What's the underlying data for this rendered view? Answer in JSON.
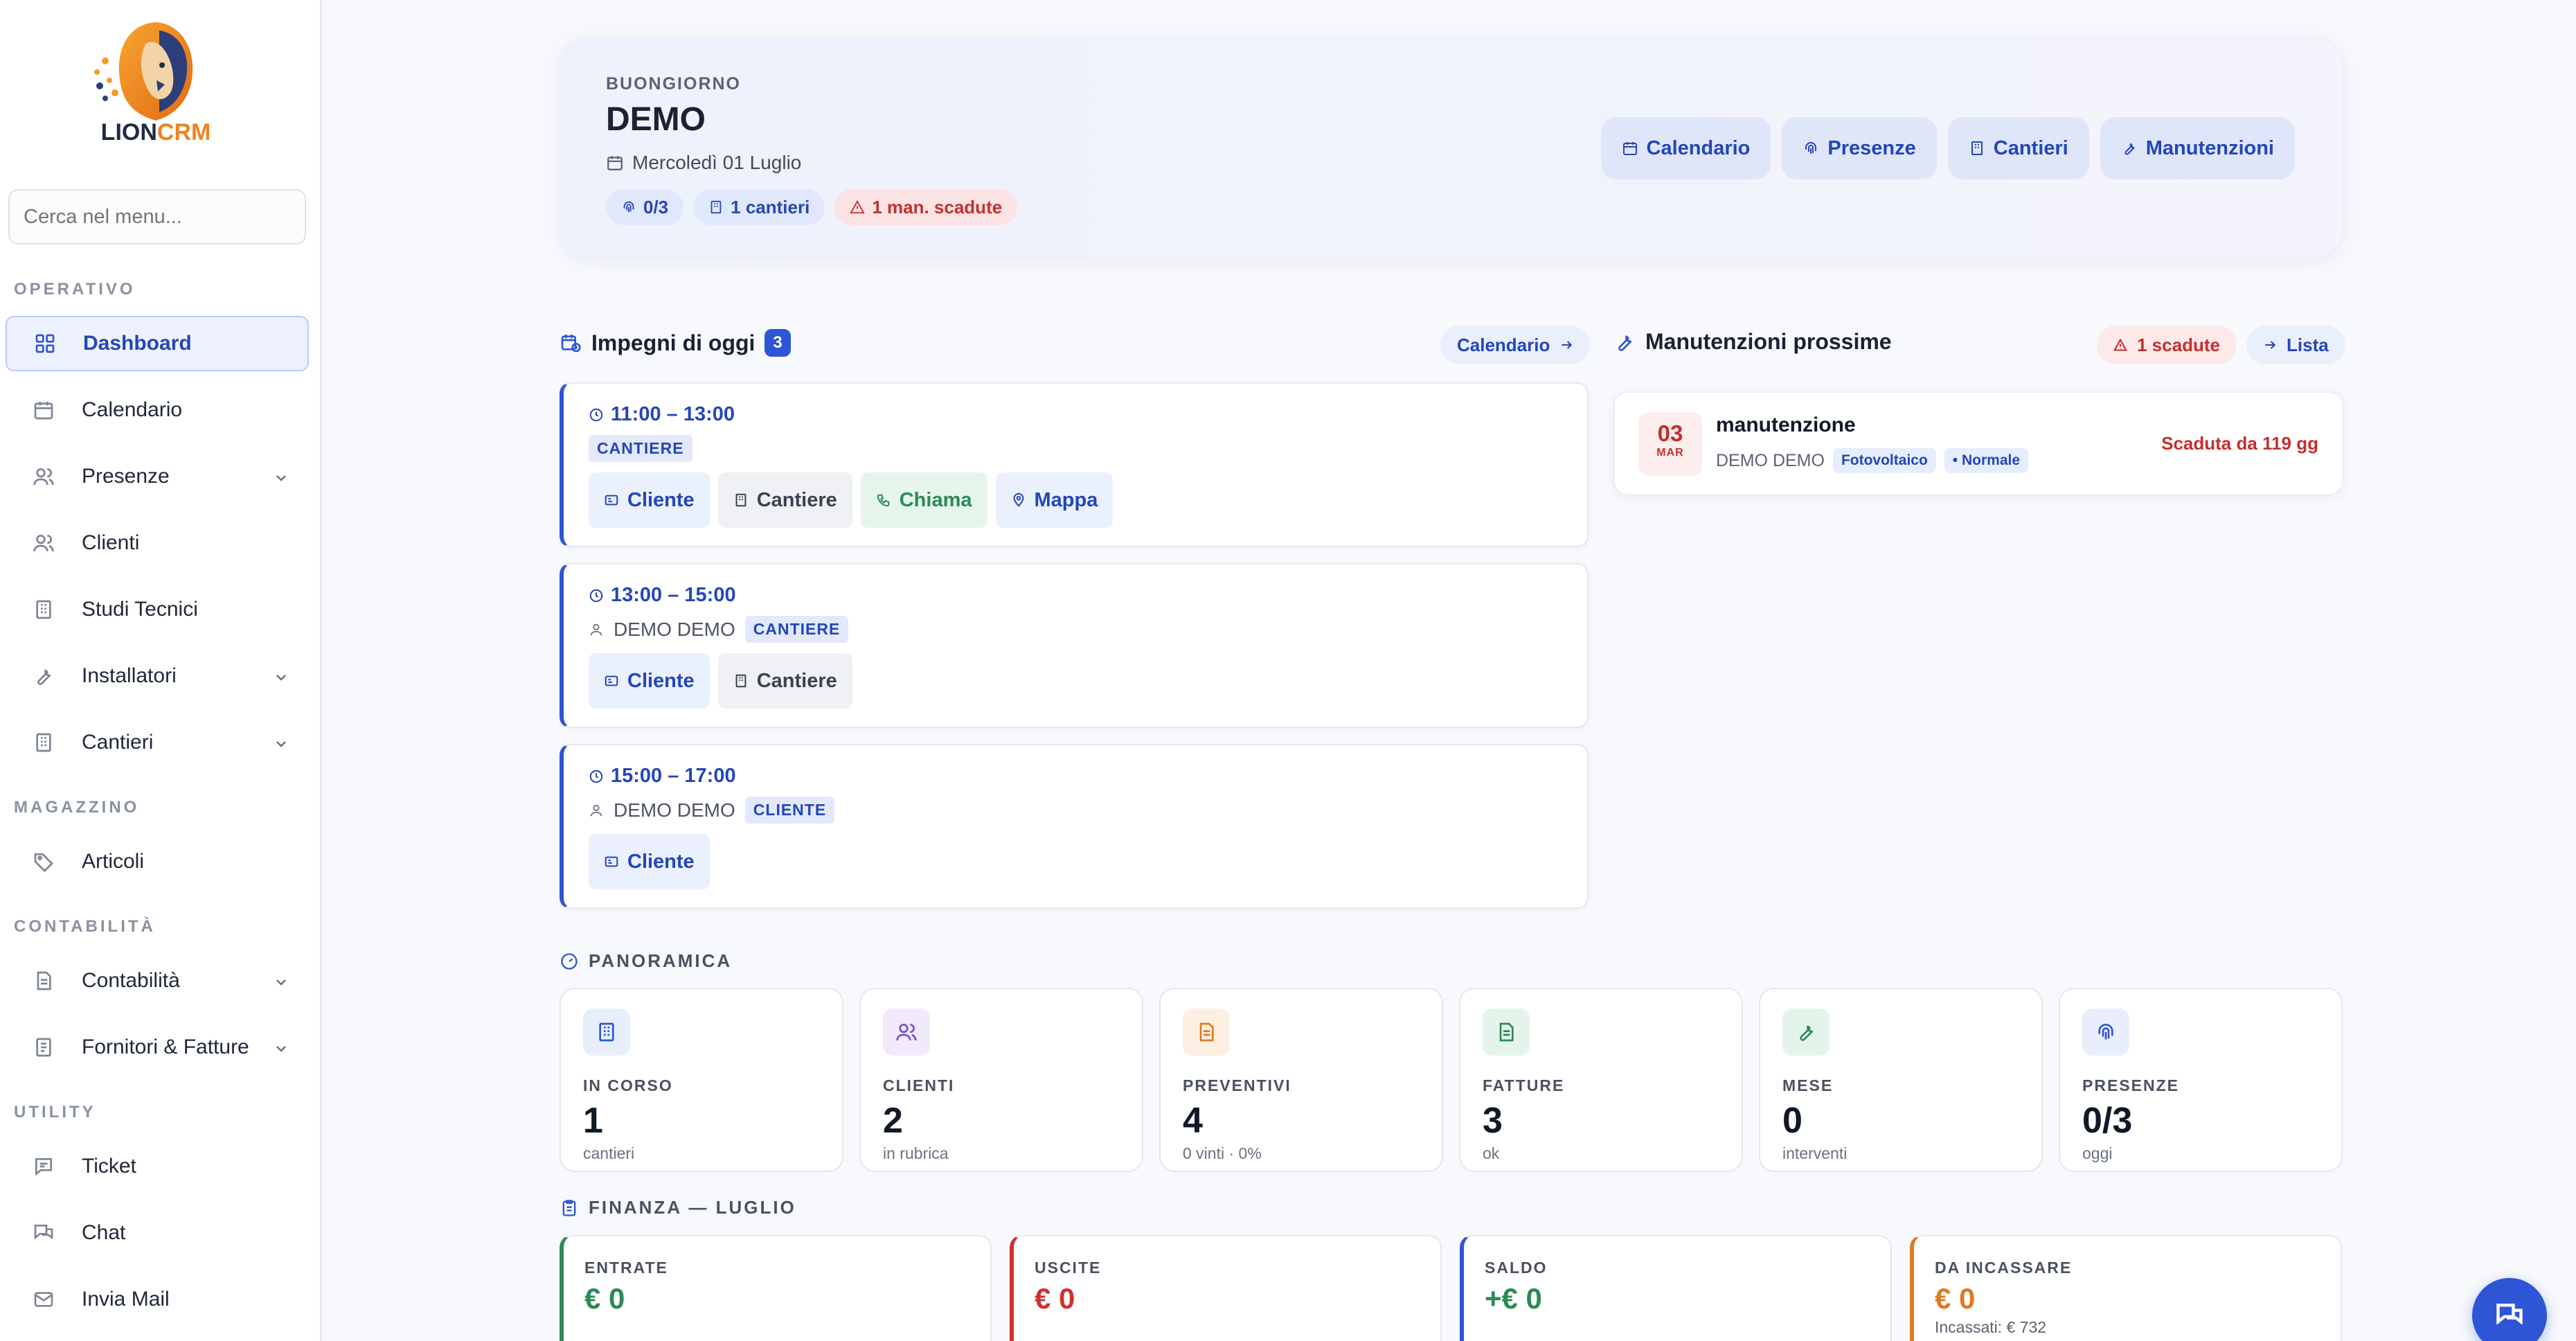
{
  "app": {
    "logo_word_a": "LION",
    "logo_word_b": "CRM"
  },
  "sidebar": {
    "search_placeholder": "Cerca nel menu...",
    "sections": {
      "operativo": "OPERATIVO",
      "magazzino": "MAGAZZINO",
      "contabilita": "CONTABILITÀ",
      "utility": "UTILITY"
    },
    "items": {
      "dashboard": "Dashboard",
      "calendario": "Calendario",
      "presenze": "Presenze",
      "clienti": "Clienti",
      "studi": "Studi Tecnici",
      "installatori": "Installatori",
      "cantieri": "Cantieri",
      "articoli": "Articoli",
      "contabilita": "Contabilità",
      "fornitori": "Fornitori & Fatture",
      "ticket": "Ticket",
      "chat": "Chat",
      "mail": "Invia Mail"
    }
  },
  "hero": {
    "greeting": "BUONGIORNO",
    "name": "DEMO",
    "date": "Mercoledì 01 Luglio",
    "badges": {
      "presenze": "0/3",
      "cantieri": "1 cantieri",
      "scadute": "1 man. scadute"
    },
    "actions": {
      "calendario": "Calendario",
      "presenze": "Presenze",
      "cantieri": "Cantieri",
      "manutenzioni": "Manutenzioni"
    }
  },
  "impegni": {
    "title": "Impegni di oggi",
    "count": "3",
    "link": "Calendario",
    "items": [
      {
        "time": "11:00 – 13:00",
        "tag": "CANTIERE",
        "btn_cliente": "Cliente",
        "btn_cantiere": "Cantiere",
        "btn_chiama": "Chiama",
        "btn_mappa": "Mappa"
      },
      {
        "time": "13:00 – 15:00",
        "person": "DEMO DEMO",
        "tag": "CANTIERE",
        "btn_cliente": "Cliente",
        "btn_cantiere": "Cantiere"
      },
      {
        "time": "15:00 – 17:00",
        "person": "DEMO DEMO",
        "tag": "CLIENTE",
        "btn_cliente": "Cliente"
      }
    ]
  },
  "manutenzioni": {
    "title": "Manutenzioni prossime",
    "overdue_pill": "1 scadute",
    "list_link": "Lista",
    "item": {
      "day": "03",
      "month": "MAR",
      "title": "manutenzione",
      "client": "DEMO DEMO",
      "type": "Fotovoltaico",
      "priority": "Normale",
      "status": "Scaduta da 119 gg"
    }
  },
  "panoramica": {
    "title": "PANORAMICA",
    "kpis": [
      {
        "label": "IN CORSO",
        "value": "1",
        "sub": "cantieri",
        "icon": "building-icon",
        "color": "#2e55d6"
      },
      {
        "label": "CLIENTI",
        "value": "2",
        "sub": "in rubrica",
        "icon": "users-icon",
        "color": "#7c4dce"
      },
      {
        "label": "PREVENTIVI",
        "value": "4",
        "sub": "0 vinti · 0%",
        "icon": "document-icon",
        "color": "#e07a1f"
      },
      {
        "label": "FATTURE",
        "value": "3",
        "sub": "ok",
        "icon": "invoice-icon",
        "color": "#2c8a55"
      },
      {
        "label": "MESE",
        "value": "0",
        "sub": "interventi",
        "icon": "wrench-icon",
        "color": "#2c8a55"
      },
      {
        "label": "PRESENZE",
        "value": "0/3",
        "sub": "oggi",
        "icon": "fingerprint-icon",
        "color": "#2e55d6"
      }
    ]
  },
  "finanza": {
    "title": "FINANZA — LUGLIO",
    "cards": [
      {
        "label": "ENTRATE",
        "value": "€ 0",
        "color": "#2c8a55"
      },
      {
        "label": "USCITE",
        "value": "€ 0",
        "color": "#d12f2f"
      },
      {
        "label": "SALDO",
        "value": "+€ 0",
        "color": "#2e55d6"
      },
      {
        "label": "DA INCASSARE",
        "value": "€ 0",
        "sub": "Incassati: € 732",
        "color": "#e07a1f"
      }
    ]
  }
}
